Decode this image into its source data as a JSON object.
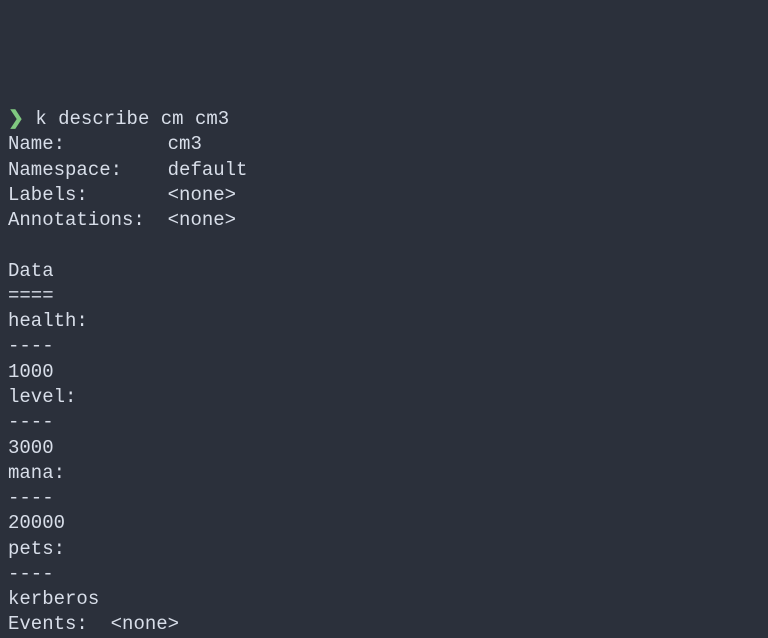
{
  "prompt": {
    "symbol": "❯",
    "command": "k describe cm cm3"
  },
  "metadata": {
    "name_label": "Name:",
    "name_value": "cm3",
    "namespace_label": "Namespace:",
    "namespace_value": "default",
    "labels_label": "Labels:",
    "labels_value": "<none>",
    "annotations_label": "Annotations:",
    "annotations_value": "<none>"
  },
  "data_section": {
    "header": "Data",
    "header_sep": "====",
    "item_sep": "----",
    "items": [
      {
        "key": "health:",
        "value": "1000"
      },
      {
        "key": "level:",
        "value": "3000"
      },
      {
        "key": "mana:",
        "value": "20000"
      },
      {
        "key": "pets:",
        "value": "kerberos"
      }
    ]
  },
  "events": {
    "label": "Events:",
    "value": "<none>"
  }
}
